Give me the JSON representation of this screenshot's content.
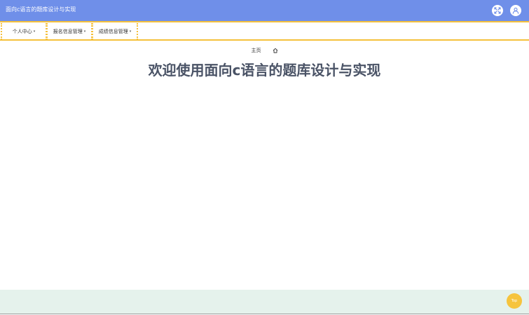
{
  "header": {
    "title": "面向c语言的题库设计与实现",
    "fullscreen_icon": "fullscreen-icon",
    "user_icon": "user-avatar-icon"
  },
  "menu": {
    "items": [
      {
        "label": "个人中心"
      },
      {
        "label": "报名信息管理"
      },
      {
        "label": "成绩信息管理"
      }
    ],
    "caret_icon": "chevron-down-icon"
  },
  "breadcrumb": {
    "home_label": "主页",
    "home_icon": "home-icon"
  },
  "main": {
    "welcome": "欢迎使用面向c语言的题库设计与实现"
  },
  "back_to_top": {
    "label": "Top"
  },
  "colors": {
    "header_bg": "#6f8fe9",
    "accent": "#f5c13c",
    "footer_bg": "#e5f2ec",
    "title_text": "#4a5366"
  }
}
